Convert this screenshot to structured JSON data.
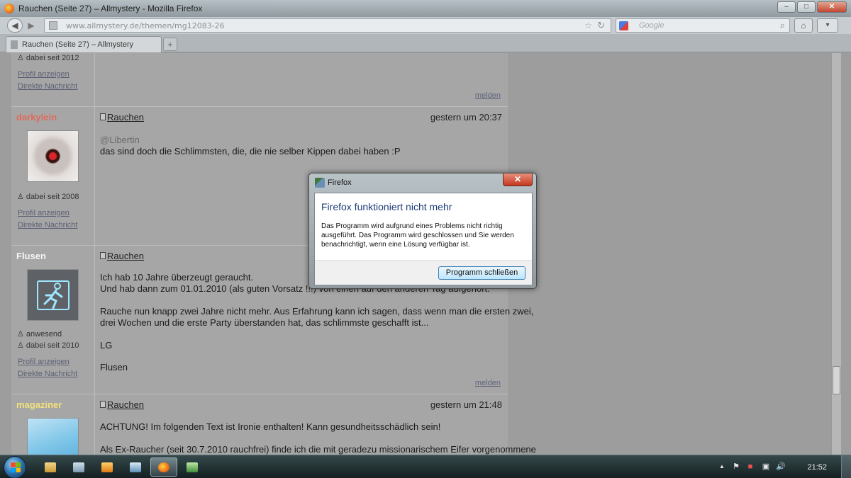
{
  "window": {
    "title": "Rauchen (Seite 27) – Allmystery - Mozilla Firefox",
    "minimize_glyph": "–",
    "maximize_glyph": "□",
    "close_glyph": "✕"
  },
  "navbar": {
    "back_glyph": "◀",
    "forward_glyph": "▶",
    "url": "www.allmystery.de/themen/mg12083-26",
    "search_placeholder": "Google",
    "star_glyph": "☆",
    "reload_glyph": "↻",
    "search_glyph": "⌕",
    "home_glyph": "⌂",
    "menu_glyph": "▾"
  },
  "tabs": [
    {
      "label": "Rauchen (Seite 27) – Allmystery"
    }
  ],
  "newtab_glyph": "+",
  "posts": [
    {
      "side": {
        "since": "dabei seit 2012",
        "profile_link": "Profil anzeigen",
        "message_link": "Direkte Nachricht"
      },
      "report": "melden"
    },
    {
      "username": "darkylein",
      "username_color": "#e06a5a",
      "since": "dabei seit 2008",
      "profile_link": "Profil anzeigen",
      "message_link": "Direkte Nachricht",
      "thread": "Rauchen",
      "date": "gestern um 20:37",
      "quote": "@Libertin",
      "text": "das sind doch die Schlimmsten, die, die nie selber Kippen dabei haben :P"
    },
    {
      "username": "Flusen",
      "username_color": "#f5f5f5",
      "status": "anwesend",
      "since": "dabei seit 2010",
      "profile_link": "Profil anzeigen",
      "message_link": "Direkte Nachricht",
      "thread": "Rauchen",
      "lines": [
        "Ich hab 10 Jahre überzeugt geraucht.",
        "Und hab dann zum 01.01.2010 (als guten Vorsatz !!!) von einen auf den anderen Tag aufgehört.",
        "Rauche nun knapp zwei Jahre nicht mehr. Aus Erfahrung kann ich sagen, dass wenn man die ersten zwei,",
        "drei Wochen und die erste Party überstanden hat, das schlimmste geschafft ist...",
        "LG",
        "Flusen"
      ],
      "report": "melden"
    },
    {
      "username": "magaziner",
      "username_color": "#f2e27a",
      "thread": "Rauchen",
      "date": "gestern um 21:48",
      "lines": [
        "ACHTUNG! Im folgenden Text ist Ironie enthalten! Kann gesundheitsschädlich sein!",
        "Als Ex-Raucher (seit 30.7.2010 rauchfrei) finde ich die mit geradezu missionarischem Eifer vorgenommene"
      ]
    }
  ],
  "dialog": {
    "title": "Firefox",
    "close_glyph": "✕",
    "heading": "Firefox funktioniert nicht mehr",
    "message": "Das Programm wird aufgrund eines Problems nicht richtig ausgeführt. Das Programm wird geschlossen und Sie werden benachrichtigt, wenn eine Lösung verfügbar ist.",
    "button": "Programm schließen"
  },
  "taskbar": {
    "items": [
      "explorer",
      "media-center",
      "media-player",
      "control-panel",
      "firefox",
      "photo-viewer"
    ],
    "clock": "21:52",
    "tray_up_glyph": "▲",
    "tray_volume_glyph": "🔊"
  },
  "colors": {
    "heading_blue": "#1d3b7a",
    "button_border": "#3c7fb1"
  }
}
